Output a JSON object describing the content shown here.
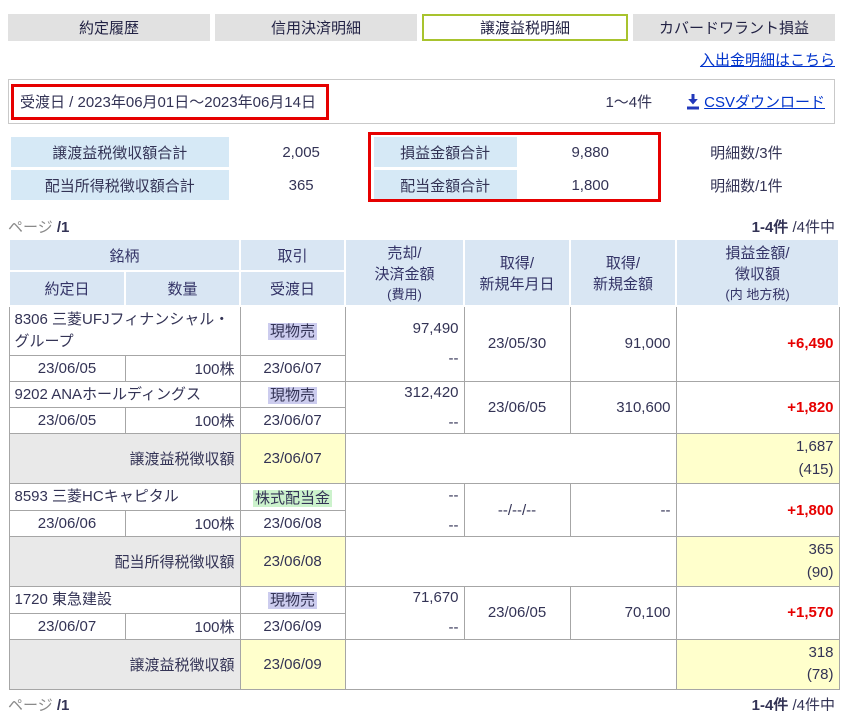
{
  "colors": {
    "accent_red": "#e60000",
    "gain_red": "#e60000",
    "link_blue": "#0033cc",
    "active_tab_border": "#a8c32e",
    "inactive_tab_bg": "#e1e1e1",
    "header_blue": "#d9e6f3",
    "summary_label_blue": "#d6e9f6",
    "highlight_yellow": "#ffffcc",
    "tax_label_gray": "#e9e9e9",
    "trade_sell_bg": "#ccccee",
    "trade_dividend_bg": "#ccf2cc"
  },
  "tabs": [
    {
      "label": "約定履歴"
    },
    {
      "label": "信用決済明細"
    },
    {
      "label": "譲渡益税明細"
    },
    {
      "label": "カバードワラント損益"
    }
  ],
  "deposit_link": "入出金明細はこちら",
  "filter_bar": {
    "date_range": "受渡日 / 2023年06月01日～2023年06月14日",
    "count": "1～4件",
    "csv_label": "CSVダウンロード"
  },
  "summary": {
    "rows": [
      {
        "tax_label": "譲渡益税徴収額合計",
        "tax_value": "2,005",
        "amount_label": "損益金額合計",
        "amount_value": "9,880",
        "detail_count": "明細数/3件"
      },
      {
        "tax_label": "配当所得税徴収額合計",
        "tax_value": "365",
        "amount_label": "配当金額合計",
        "amount_value": "1,800",
        "detail_count": "明細数/1件"
      }
    ]
  },
  "pagination": {
    "page_label": "ページ",
    "page_value": "/1",
    "range": "1-4件",
    "total": " /4件中"
  },
  "table": {
    "headers": {
      "stock": "銘柄",
      "exec_date": "約定日",
      "qty": "数量",
      "trade": "取引",
      "settle_date": "受渡日",
      "sell_1": "売却/",
      "sell_2": "決済金額",
      "sell_3": "(費用)",
      "acq_date_1": "取得/",
      "acq_date_2": "新規年月日",
      "acq_amt_1": "取得/",
      "acq_amt_2": "新規金額",
      "pl_1": "損益金額/",
      "pl_2": "徴収額",
      "pl_3": "(内 地方税)"
    },
    "rows": [
      {
        "code_name": "8306 三菱UFJフィナンシャル・グループ",
        "trade": "現物売",
        "sell_amount": "97,490",
        "sell_cost": "--",
        "exec_date": "23/06/05",
        "qty": "100株",
        "settle_date": "23/06/07",
        "acq_date": "23/05/30",
        "acq_amount": "91,000",
        "pl": "+6,490"
      },
      {
        "code_name": "9202 ANAホールディングス",
        "trade": "現物売",
        "sell_amount": "312,420",
        "sell_cost": "--",
        "exec_date": "23/06/05",
        "qty": "100株",
        "settle_date": "23/06/07",
        "acq_date": "23/06/05",
        "acq_amount": "310,600",
        "pl": "+1,820"
      },
      {
        "label": "譲渡益税徴収額",
        "settle_date": "23/06/07",
        "amount": "1,687",
        "local_tax": "(415)"
      },
      {
        "code_name": "8593 三菱HCキャピタル",
        "trade": "株式配当金",
        "sell_amount": "--",
        "sell_cost": "--",
        "exec_date": "23/06/06",
        "qty": "100株",
        "settle_date": "23/06/08",
        "acq_date": "--/--/--",
        "acq_amount": "--",
        "pl": "+1,800"
      },
      {
        "label": "配当所得税徴収額",
        "settle_date": "23/06/08",
        "amount": "365",
        "local_tax": "(90)"
      },
      {
        "code_name": "1720 東急建設",
        "trade": "現物売",
        "sell_amount": "71,670",
        "sell_cost": "--",
        "exec_date": "23/06/07",
        "qty": "100株",
        "settle_date": "23/06/09",
        "acq_date": "23/06/05",
        "acq_amount": "70,100",
        "pl": "+1,570"
      },
      {
        "label": "譲渡益税徴収額",
        "settle_date": "23/06/09",
        "amount": "318",
        "local_tax": "(78)"
      }
    ]
  }
}
